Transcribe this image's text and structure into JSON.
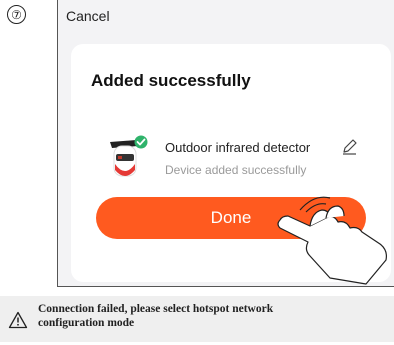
{
  "step": {
    "number": "⑦"
  },
  "header": {
    "cancel_label": "Cancel"
  },
  "card": {
    "title": "Added successfully",
    "device": {
      "name": "Outdoor infrared detector",
      "status": "Device added successfully",
      "icon": "infrared-detector-icon"
    },
    "done_label": "Done"
  },
  "warning": {
    "icon": "warning-triangle-icon",
    "line1": "Connection failed, please select hotspot network",
    "line2": "configuration mode"
  },
  "colors": {
    "accent": "#ff5a1f",
    "success": "#2fb36b",
    "background": "#f3f3f5"
  }
}
